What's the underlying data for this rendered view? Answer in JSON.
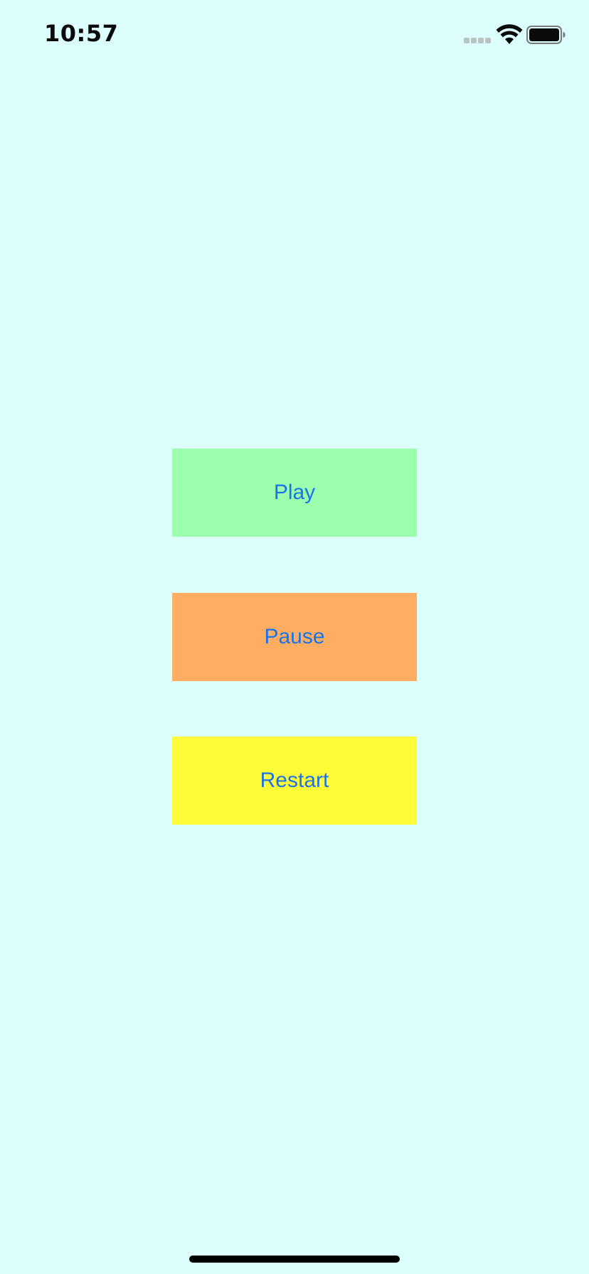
{
  "status_bar": {
    "time": "10:57",
    "signal_icon": "cellular-signal-icon",
    "wifi_icon": "wifi-icon",
    "battery_icon": "battery-icon"
  },
  "buttons": {
    "play_label": "Play",
    "pause_label": "Pause",
    "restart_label": "Restart"
  },
  "colors": {
    "background": "#dcfffd",
    "play_bg": "#9bffad",
    "pause_bg": "#ffad62",
    "restart_bg": "#fffb3a",
    "button_text": "#1a74e8"
  }
}
